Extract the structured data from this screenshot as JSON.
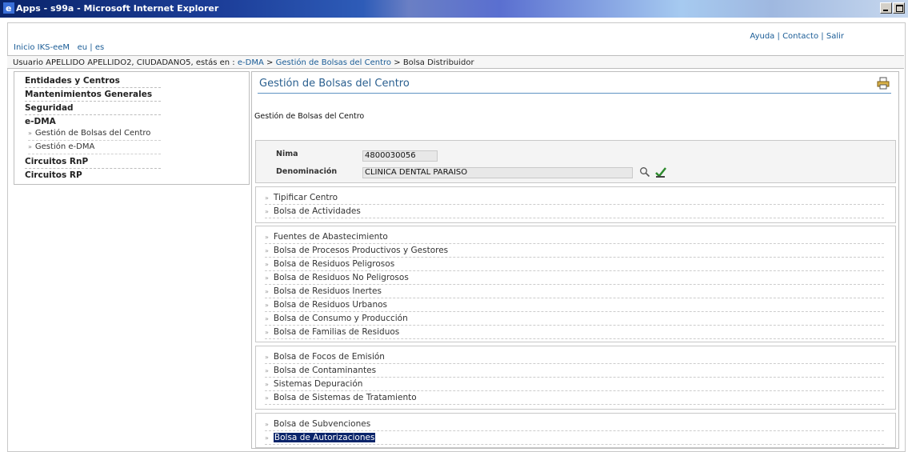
{
  "window": {
    "title": "Apps - s99a - Microsoft Internet Explorer"
  },
  "top": {
    "inicio": "Inicio IKS-eeM",
    "lang_eu": "eu",
    "sep": "|",
    "lang_es": "es",
    "ayuda": "Ayuda",
    "contacto": "Contacto",
    "salir": "Salir"
  },
  "breadcrumb": {
    "prefix": "Usuario APELLIDO APELLIDO2, CIUDADANO5, estás en :",
    "crumb1": "e-DMA",
    "gt": ">",
    "crumb2": "Gestión de Bolsas del Centro",
    "current": "Bolsa Distribuidor"
  },
  "sidebar": {
    "items": [
      "Entidades y Centros",
      "Mantenimientos Generales",
      "Seguridad",
      "e-DMA",
      "Circuitos RnP",
      "Circuitos RP"
    ],
    "sub": [
      "Gestión de Bolsas del Centro",
      "Gestión e-DMA"
    ],
    "arrow": "»"
  },
  "main": {
    "header": "Gestión de Bolsas del Centro",
    "subtitle": "Gestión de Bolsas del Centro",
    "fields": {
      "nima_label": "Nima",
      "nima_value": "4800030056",
      "denom_label": "Denominación",
      "denom_value": "CLINICA DENTAL PARAISO"
    },
    "group1": [
      "Tipificar Centro",
      "Bolsa de Actividades"
    ],
    "group2": [
      "Fuentes de Abastecimiento",
      "Bolsa de Procesos Productivos y Gestores",
      "Bolsa de Residuos Peligrosos",
      "Bolsa de Residuos No Peligrosos",
      "Bolsa de Residuos Inertes",
      "Bolsa de Residuos Urbanos",
      "Bolsa de Consumo y Producción",
      "Bolsa de Familias de Residuos"
    ],
    "group3": [
      "Bolsa de Focos de Emisión",
      "Bolsa de Contaminantes",
      "Sistemas Depuración",
      "Bolsa de Sistemas de Tratamiento"
    ],
    "group4": [
      "Bolsa de Subvenciones",
      "Bolsa de Autorizaciones"
    ]
  },
  "icons": {
    "search": "search-icon",
    "validate": "check-edit-icon",
    "print": "printer-icon"
  }
}
